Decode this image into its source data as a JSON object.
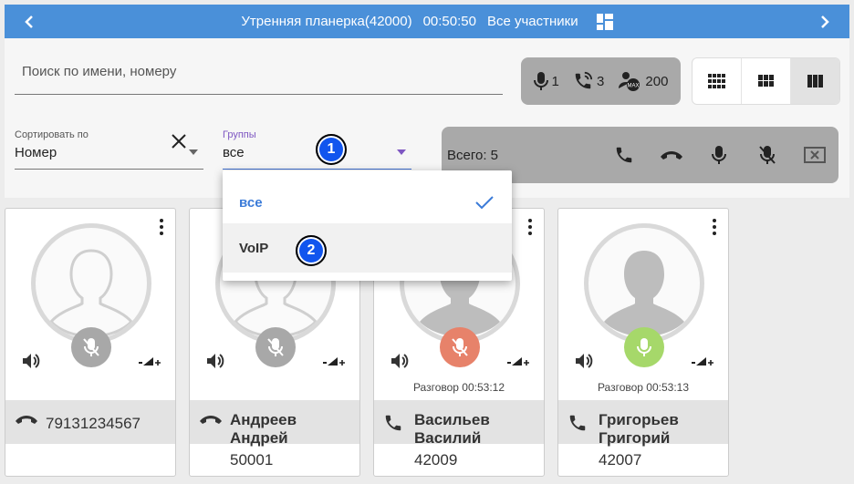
{
  "header": {
    "conference_title": "Утренняя планерка(42000)",
    "timer": "00:50:50",
    "view_label": "Все участники"
  },
  "search": {
    "placeholder": "Поиск по имени, номеру"
  },
  "stats": {
    "mic_count": "1",
    "calls_count": "3",
    "max_count": "200"
  },
  "sort": {
    "label": "Сортировать по",
    "value": "Номер"
  },
  "groups": {
    "label": "Группы",
    "value": "все",
    "options": [
      {
        "label": "все",
        "selected": true
      },
      {
        "label": "VoIP",
        "selected": false
      }
    ]
  },
  "actions": {
    "total": "Всего: 5"
  },
  "markers": [
    "1",
    "2"
  ],
  "cards": [
    {
      "name_line1": "",
      "name_line2": "",
      "number": "79131234567",
      "extension": "",
      "talk": "",
      "mic_color": "#a8a8a8",
      "call_icon": "hangup-icon"
    },
    {
      "name_line1": "Андреев",
      "name_line2": "Андрей",
      "number": "",
      "extension": "50001",
      "talk": "",
      "mic_color": "#a8a8a8",
      "call_icon": "hangup-icon"
    },
    {
      "name_line1": "Васильев",
      "name_line2": "Василий",
      "number": "",
      "extension": "42009",
      "talk": "Разговор 00:53:12",
      "mic_color": "#e7826a",
      "call_icon": "phone-icon"
    },
    {
      "name_line1": "Григорьев",
      "name_line2": "Григорий",
      "number": "",
      "extension": "42007",
      "talk": "Разговор 00:53:13",
      "mic_color": "#a6d86a",
      "call_icon": "phone-icon"
    }
  ],
  "colors": {
    "header": "#4a90d9",
    "accent": "#3b7bd8",
    "marker": "#1155ee"
  }
}
